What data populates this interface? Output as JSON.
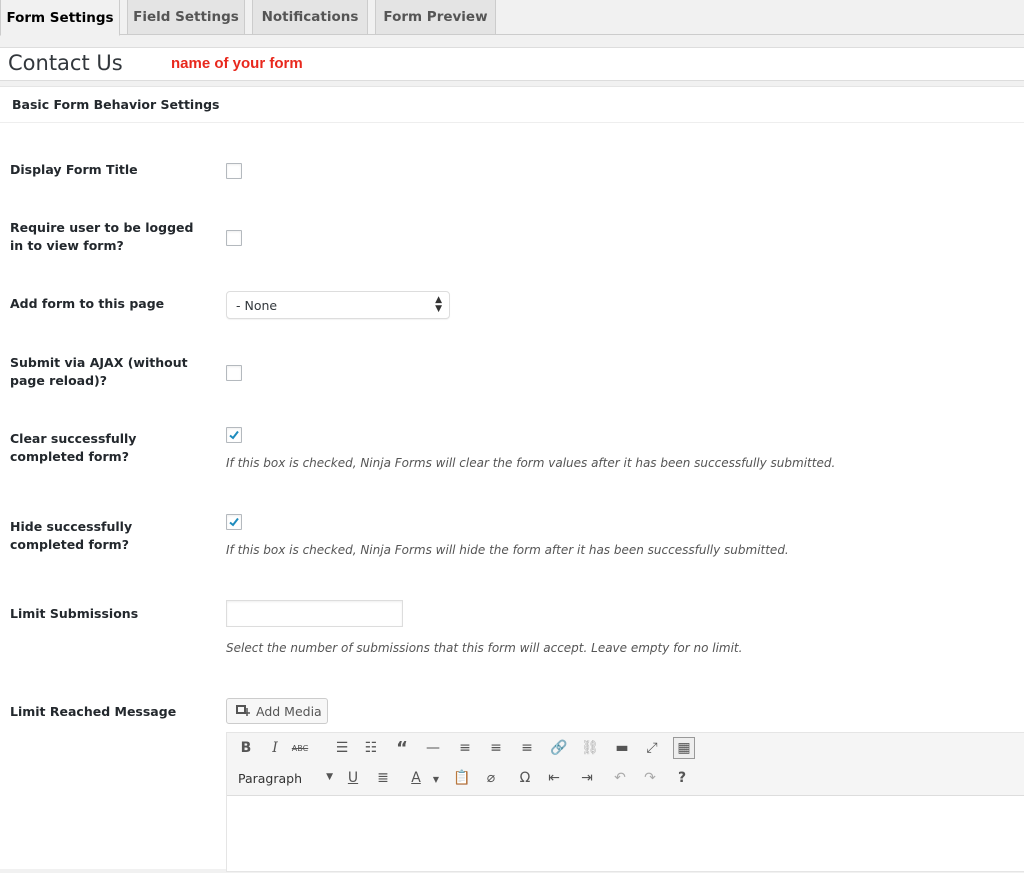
{
  "tabs": [
    {
      "label": "Form Settings",
      "active": true
    },
    {
      "label": "Field Settings",
      "active": false
    },
    {
      "label": "Notifications",
      "active": false
    },
    {
      "label": "Form Preview",
      "active": false
    }
  ],
  "form": {
    "title": "Contact Us",
    "annotation": "name of your form",
    "annotation_color": "#e8281d"
  },
  "section": {
    "title": "Basic Form Behavior Settings"
  },
  "settings": {
    "display_title": {
      "label": "Display Form Title",
      "checked": false
    },
    "logged_in": {
      "label": "Require user to be logged in to view form?",
      "checked": false
    },
    "add_page": {
      "label": "Add form to this page",
      "selected": "- None"
    },
    "ajax": {
      "label": "Submit via AJAX (without page reload)?",
      "checked": false
    },
    "clear_complete": {
      "label": "Clear successfully completed form?",
      "checked": true,
      "description": "If this box is checked, Ninja Forms will clear the form values after it has been successfully submitted."
    },
    "hide_complete": {
      "label": "Hide successfully completed form?",
      "checked": true,
      "description": "If this box is checked, Ninja Forms will hide the form after it has been successfully submitted."
    },
    "limit_submissions": {
      "label": "Limit Submissions",
      "value": "",
      "description": "Select the number of submissions that this form will accept. Leave empty for no limit."
    },
    "limit_message": {
      "label": "Limit Reached Message",
      "add_media_label": "Add Media",
      "format_value": "Paragraph",
      "editor_content": ""
    }
  },
  "colors": {
    "check": "#1e8cbe",
    "accent_red": "#e8281d"
  },
  "icons": {
    "row1": [
      "bold-icon",
      "italic-icon",
      "strikethrough-icon",
      "bullet-list-icon",
      "numbered-list-icon",
      "blockquote-icon",
      "horizontal-rule-icon",
      "align-left-icon",
      "align-center-icon",
      "align-right-icon",
      "link-icon",
      "unlink-icon",
      "read-more-icon",
      "fullscreen-icon",
      "toolbar-toggle-icon"
    ],
    "row2": [
      "underline-icon",
      "justify-icon",
      "text-color-icon",
      "paste-text-icon",
      "clear-formatting-icon",
      "special-character-icon",
      "outdent-icon",
      "indent-icon",
      "undo-icon",
      "redo-icon",
      "help-icon"
    ]
  }
}
